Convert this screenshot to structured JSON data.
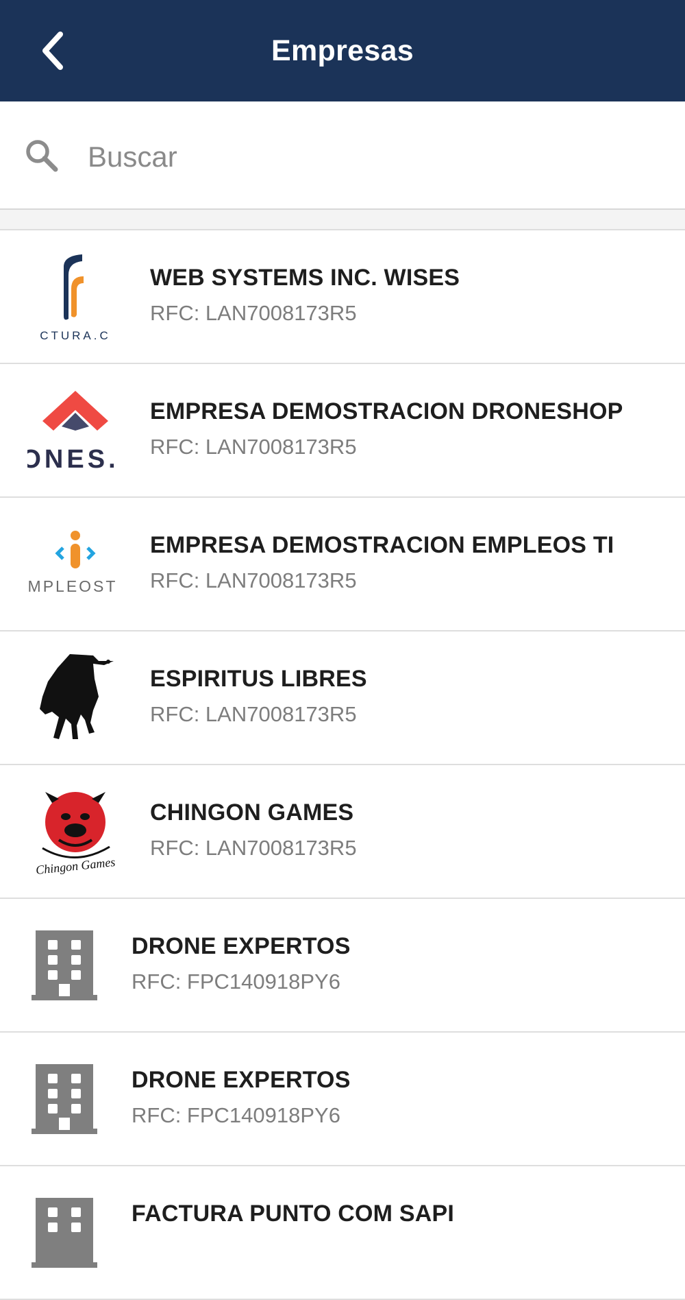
{
  "header": {
    "title": "Empresas"
  },
  "search": {
    "placeholder": "Buscar"
  },
  "companies": [
    {
      "name": "WEB SYSTEMS INC. WISES",
      "rfc": "RFC: LAN7008173R5",
      "logo_text": "CTURA.C"
    },
    {
      "name": "EMPRESA DEMOSTRACION DRONESHOP",
      "rfc": "RFC: LAN7008173R5",
      "logo_text": "ONES."
    },
    {
      "name": "EMPRESA DEMOSTRACION EMPLEOS TI",
      "rfc": "RFC: LAN7008173R5",
      "logo_text": "MPLEOST"
    },
    {
      "name": "ESPIRITUS LIBRES",
      "rfc": "RFC: LAN7008173R5"
    },
    {
      "name": "CHINGON GAMES",
      "rfc": "RFC: LAN7008173R5",
      "logo_text": "Chingon Games"
    },
    {
      "name": "DRONE EXPERTOS",
      "rfc": "RFC: FPC140918PY6"
    },
    {
      "name": "DRONE EXPERTOS",
      "rfc": "RFC: FPC140918PY6"
    },
    {
      "name": "FACTURA PUNTO COM SAPI"
    }
  ],
  "icons": {
    "back": "chevron-left-icon",
    "search": "search-icon",
    "building": "building-icon"
  },
  "colors": {
    "header_bg": "#1b3358",
    "building_icon": "#7f7f7f"
  }
}
